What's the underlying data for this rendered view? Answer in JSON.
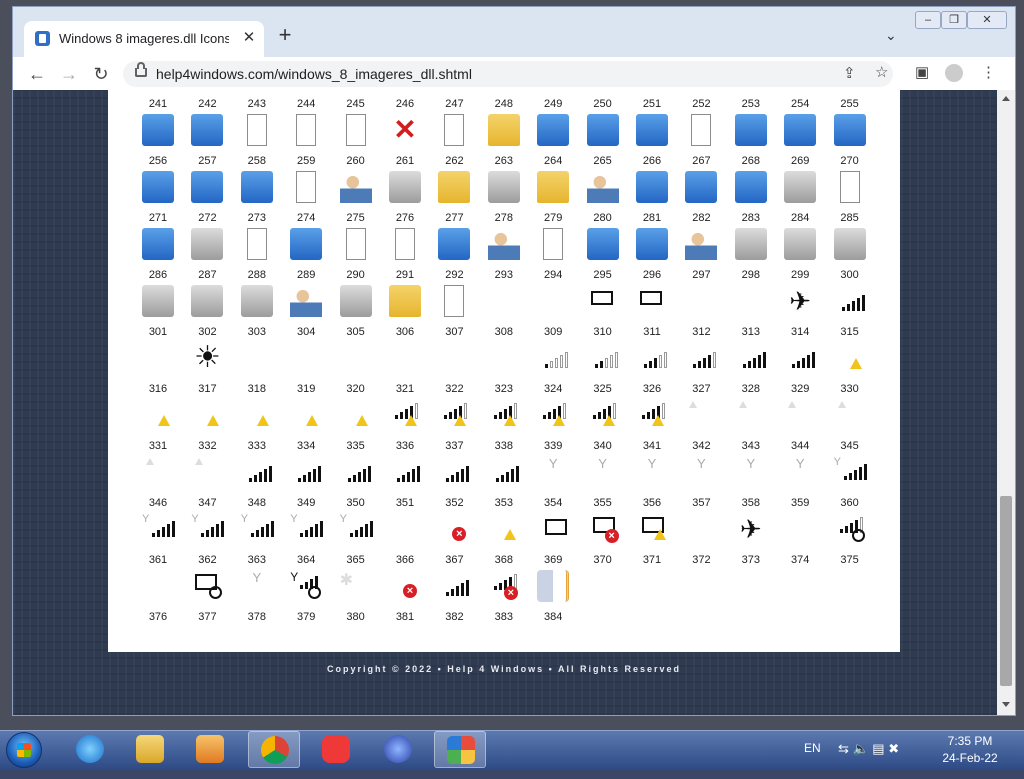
{
  "browser": {
    "tab_title": "Windows 8 imageres.dll Icons &",
    "url": "help4windows.com/windows_8_imageres_dll.shtml",
    "window_controls": [
      "–",
      "❐",
      "✕"
    ]
  },
  "page": {
    "top_row_numbers": [
      "241",
      "242",
      "243",
      "244",
      "245",
      "246",
      "247",
      "248",
      "249",
      "250",
      "251",
      "252",
      "253",
      "254",
      "255"
    ],
    "rows": [
      {
        "numbers": [
          "256",
          "257",
          "258",
          "259",
          "260",
          "261",
          "262",
          "263",
          "264",
          "265",
          "266",
          "267",
          "268",
          "269",
          "270"
        ],
        "icons": [
          "magnifier-icon",
          "window-icon",
          "document-stack-icon",
          "document-icon",
          "document-icon",
          "red-x-icon",
          "upload-document-icon",
          "upload-folder-icon",
          "upload-list-icon",
          "play-arrow-icon",
          "grid-icon",
          "play-document-icon",
          "share-arrow-icon",
          "share-arrow-icon",
          "photo-icon"
        ]
      },
      {
        "numbers": [
          "271",
          "272",
          "273",
          "274",
          "275",
          "276",
          "277",
          "278",
          "279",
          "280",
          "281",
          "282",
          "283",
          "284",
          "285"
        ],
        "icons": [
          "presentation-icon",
          "undo-arrow-icon",
          "undo-grid-icon",
          "edit-document-icon",
          "user-computer-icon",
          "drive-icon",
          "clock-folder-icon",
          "connector-icon",
          "check-folder-icon",
          "check-users-icon",
          "copy-icon",
          "undo-list-icon",
          "window-pane-icon",
          "keys-icon",
          "list-icon"
        ]
      },
      {
        "numbers": [
          "286",
          "287",
          "288",
          "289",
          "290",
          "291",
          "292",
          "293",
          "294",
          "295",
          "296",
          "297",
          "298",
          "299",
          "300"
        ],
        "icons": [
          "media-icon",
          "printer-icon",
          "checklist-icon",
          "network-icon",
          "table-icon",
          "check-document-icon",
          "clock-x-icon",
          "user-block-icon",
          "form-icon",
          "devices-icon",
          "powershell-icon",
          "user-card-icon",
          "printer-computer-icon",
          "printer-network-icon",
          "windows-connector-icon"
        ]
      },
      {
        "numbers": [
          "301",
          "302",
          "303",
          "304",
          "305",
          "306",
          "307",
          "308",
          "309",
          "310",
          "311",
          "312",
          "313",
          "314",
          "315"
        ],
        "icons": [
          "disk-icon",
          "disk-x-icon",
          "drive-x-icon",
          "users-icon",
          "keys-gold-icon",
          "folder-icon",
          "document-x-icon",
          "blank-icon",
          "blank-icon",
          "screen-refresh-icon",
          "screen-lock-icon",
          "blank-icon",
          "blank-icon",
          "airplane-icon",
          "signal-bars-icon"
        ]
      },
      {
        "numbers": [
          "316",
          "317",
          "318",
          "319",
          "320",
          "321",
          "322",
          "323",
          "324",
          "325",
          "326",
          "327",
          "328",
          "329",
          "330"
        ],
        "icons": [
          "blank-icon",
          "sun-icon",
          "blank-icon",
          "blank-icon",
          "blank-icon",
          "blank-icon",
          "blank-icon",
          "blank-icon",
          "signal-1-icon",
          "signal-2-icon",
          "signal-3-icon",
          "signal-4-icon",
          "signal-5-icon",
          "signal-full-icon",
          "warning-icon"
        ]
      },
      {
        "numbers": [
          "331",
          "332",
          "333",
          "334",
          "335",
          "336",
          "337",
          "338",
          "339",
          "340",
          "341",
          "342",
          "343",
          "344",
          "345"
        ],
        "icons": [
          "warning-icon",
          "warning-icon",
          "warning-icon",
          "warning-icon",
          "warning-icon",
          "signal-warning-icon",
          "signal-warning-icon",
          "signal-warning-icon",
          "signal-warning-icon",
          "signal-warning-icon",
          "signal-warning-icon",
          "faint-triangle-icon",
          "faint-triangle-icon",
          "faint-triangle-icon",
          "faint-triangle-icon"
        ]
      },
      {
        "numbers": [
          "346",
          "347",
          "348",
          "349",
          "350",
          "351",
          "352",
          "353",
          "354",
          "355",
          "356",
          "357",
          "358",
          "359",
          "360"
        ],
        "icons": [
          "faint-triangle-icon",
          "faint-triangle-icon",
          "signal-bars-icon",
          "signal-bars-icon",
          "signal-bars-icon",
          "signal-bars-icon",
          "signal-bars-icon",
          "signal-bars-icon",
          "antenna-icon",
          "antenna-icon",
          "antenna-icon",
          "antenna-icon",
          "antenna-icon",
          "antenna-icon",
          "antenna-signal-icon"
        ]
      },
      {
        "numbers": [
          "361",
          "362",
          "363",
          "364",
          "365",
          "366",
          "367",
          "368",
          "369",
          "370",
          "371",
          "372",
          "373",
          "374",
          "375"
        ],
        "icons": [
          "antenna-signal-icon",
          "antenna-signal-icon",
          "antenna-signal-icon",
          "antenna-signal-icon",
          "antenna-signal-icon",
          "blank-icon",
          "error-icon",
          "warning-icon",
          "ethernet-icon",
          "ethernet-error-icon",
          "ethernet-warning-icon",
          "blank-icon",
          "airplane-icon",
          "blank-icon",
          "signal-search-icon"
        ]
      },
      {
        "numbers": [
          "376",
          "377",
          "378",
          "379",
          "380",
          "381",
          "382",
          "383",
          "384"
        ],
        "icons": [
          "blank-icon",
          "ethernet-search-icon",
          "antenna-icon",
          "antenna-search-icon",
          "asterisk-icon",
          "error-icon",
          "signal-bars-icon",
          "signal-error-icon",
          "phone-signal-icon"
        ]
      }
    ],
    "footer_text": "Copyright © 2022  •  Help 4 Windows  •  All Rights Reserved"
  },
  "taskbar": {
    "language": "EN",
    "time": "7:35 PM",
    "date": "24-Feb-22",
    "apps": [
      "internet-explorer-icon",
      "file-explorer-icon",
      "media-player-icon",
      "chrome-icon",
      "vivaldi-icon",
      "feather-app-icon",
      "resource-hacker-icon"
    ]
  }
}
